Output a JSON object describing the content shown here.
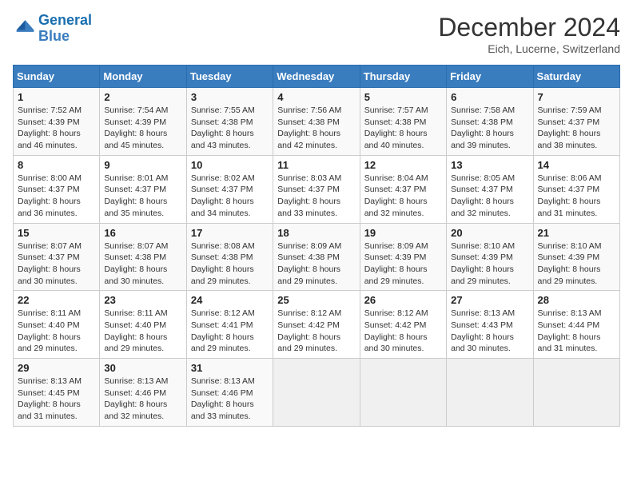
{
  "logo": {
    "line1": "General",
    "line2": "Blue"
  },
  "title": "December 2024",
  "subtitle": "Eich, Lucerne, Switzerland",
  "days_of_week": [
    "Sunday",
    "Monday",
    "Tuesday",
    "Wednesday",
    "Thursday",
    "Friday",
    "Saturday"
  ],
  "weeks": [
    [
      {
        "day": "1",
        "sunrise": "7:52 AM",
        "sunset": "4:39 PM",
        "daylight": "8 hours and 46 minutes."
      },
      {
        "day": "2",
        "sunrise": "7:54 AM",
        "sunset": "4:39 PM",
        "daylight": "8 hours and 45 minutes."
      },
      {
        "day": "3",
        "sunrise": "7:55 AM",
        "sunset": "4:38 PM",
        "daylight": "8 hours and 43 minutes."
      },
      {
        "day": "4",
        "sunrise": "7:56 AM",
        "sunset": "4:38 PM",
        "daylight": "8 hours and 42 minutes."
      },
      {
        "day": "5",
        "sunrise": "7:57 AM",
        "sunset": "4:38 PM",
        "daylight": "8 hours and 40 minutes."
      },
      {
        "day": "6",
        "sunrise": "7:58 AM",
        "sunset": "4:38 PM",
        "daylight": "8 hours and 39 minutes."
      },
      {
        "day": "7",
        "sunrise": "7:59 AM",
        "sunset": "4:37 PM",
        "daylight": "8 hours and 38 minutes."
      }
    ],
    [
      {
        "day": "8",
        "sunrise": "8:00 AM",
        "sunset": "4:37 PM",
        "daylight": "8 hours and 36 minutes."
      },
      {
        "day": "9",
        "sunrise": "8:01 AM",
        "sunset": "4:37 PM",
        "daylight": "8 hours and 35 minutes."
      },
      {
        "day": "10",
        "sunrise": "8:02 AM",
        "sunset": "4:37 PM",
        "daylight": "8 hours and 34 minutes."
      },
      {
        "day": "11",
        "sunrise": "8:03 AM",
        "sunset": "4:37 PM",
        "daylight": "8 hours and 33 minutes."
      },
      {
        "day": "12",
        "sunrise": "8:04 AM",
        "sunset": "4:37 PM",
        "daylight": "8 hours and 32 minutes."
      },
      {
        "day": "13",
        "sunrise": "8:05 AM",
        "sunset": "4:37 PM",
        "daylight": "8 hours and 32 minutes."
      },
      {
        "day": "14",
        "sunrise": "8:06 AM",
        "sunset": "4:37 PM",
        "daylight": "8 hours and 31 minutes."
      }
    ],
    [
      {
        "day": "15",
        "sunrise": "8:07 AM",
        "sunset": "4:37 PM",
        "daylight": "8 hours and 30 minutes."
      },
      {
        "day": "16",
        "sunrise": "8:07 AM",
        "sunset": "4:38 PM",
        "daylight": "8 hours and 30 minutes."
      },
      {
        "day": "17",
        "sunrise": "8:08 AM",
        "sunset": "4:38 PM",
        "daylight": "8 hours and 29 minutes."
      },
      {
        "day": "18",
        "sunrise": "8:09 AM",
        "sunset": "4:38 PM",
        "daylight": "8 hours and 29 minutes."
      },
      {
        "day": "19",
        "sunrise": "8:09 AM",
        "sunset": "4:39 PM",
        "daylight": "8 hours and 29 minutes."
      },
      {
        "day": "20",
        "sunrise": "8:10 AM",
        "sunset": "4:39 PM",
        "daylight": "8 hours and 29 minutes."
      },
      {
        "day": "21",
        "sunrise": "8:10 AM",
        "sunset": "4:39 PM",
        "daylight": "8 hours and 29 minutes."
      }
    ],
    [
      {
        "day": "22",
        "sunrise": "8:11 AM",
        "sunset": "4:40 PM",
        "daylight": "8 hours and 29 minutes."
      },
      {
        "day": "23",
        "sunrise": "8:11 AM",
        "sunset": "4:40 PM",
        "daylight": "8 hours and 29 minutes."
      },
      {
        "day": "24",
        "sunrise": "8:12 AM",
        "sunset": "4:41 PM",
        "daylight": "8 hours and 29 minutes."
      },
      {
        "day": "25",
        "sunrise": "8:12 AM",
        "sunset": "4:42 PM",
        "daylight": "8 hours and 29 minutes."
      },
      {
        "day": "26",
        "sunrise": "8:12 AM",
        "sunset": "4:42 PM",
        "daylight": "8 hours and 30 minutes."
      },
      {
        "day": "27",
        "sunrise": "8:13 AM",
        "sunset": "4:43 PM",
        "daylight": "8 hours and 30 minutes."
      },
      {
        "day": "28",
        "sunrise": "8:13 AM",
        "sunset": "4:44 PM",
        "daylight": "8 hours and 31 minutes."
      }
    ],
    [
      {
        "day": "29",
        "sunrise": "8:13 AM",
        "sunset": "4:45 PM",
        "daylight": "8 hours and 31 minutes."
      },
      {
        "day": "30",
        "sunrise": "8:13 AM",
        "sunset": "4:46 PM",
        "daylight": "8 hours and 32 minutes."
      },
      {
        "day": "31",
        "sunrise": "8:13 AM",
        "sunset": "4:46 PM",
        "daylight": "8 hours and 33 minutes."
      },
      null,
      null,
      null,
      null
    ]
  ]
}
